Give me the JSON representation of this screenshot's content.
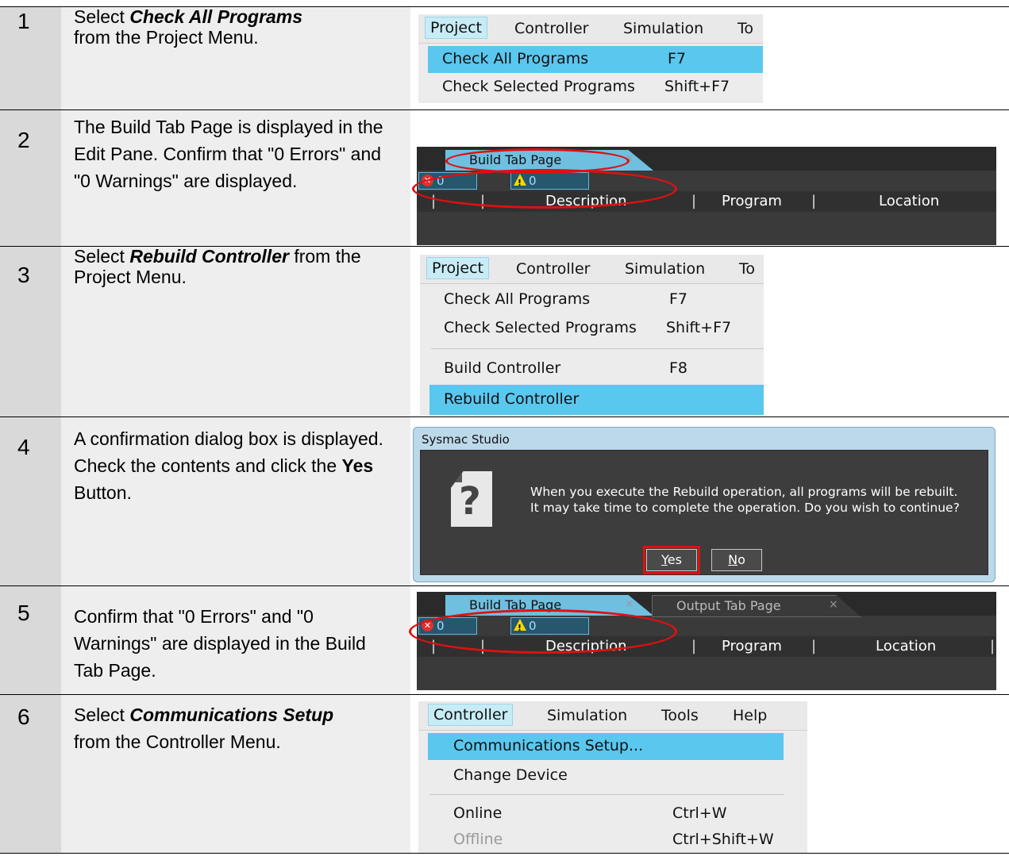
{
  "steps": [
    {
      "num": "1",
      "pre": "Select ",
      "bold": "Check All Programs",
      "post": " from the Project Menu."
    },
    {
      "num": "2",
      "text": "The Build Tab Page is displayed in the Edit Pane. Confirm that \"0 Errors\" and \"0 Warnings\" are displayed."
    },
    {
      "num": "3",
      "pre": "Select ",
      "bold": "Rebuild Controller",
      "post": " from the Project Menu."
    },
    {
      "num": "4",
      "pre": "A confirmation dialog box is displayed. Check the contents and click the ",
      "bold": "Yes",
      "post": " Button."
    },
    {
      "num": "5",
      "text": "Confirm that \"0 Errors\" and \"0 Warnings\" are displayed in the Build Tab Page."
    },
    {
      "num": "6",
      "pre": "Select ",
      "bold": "Communications Setup",
      "post": " from the Controller Menu."
    }
  ],
  "menu1": {
    "bar": [
      "Project",
      "Controller",
      "Simulation",
      "To"
    ],
    "items": [
      {
        "label": "Check All Programs",
        "shortcut": "F7"
      },
      {
        "label": "Check Selected Programs",
        "shortcut": "Shift+F7"
      }
    ]
  },
  "menu3": {
    "bar": [
      "Project",
      "Controller",
      "Simulation",
      "To"
    ],
    "items": [
      {
        "label": "Check All Programs",
        "shortcut": "F7"
      },
      {
        "label": "Check Selected Programs",
        "shortcut": "Shift+F7"
      },
      {
        "label": "Build Controller",
        "shortcut": "F8"
      },
      {
        "label": "Rebuild Controller",
        "shortcut": ""
      }
    ]
  },
  "menu6": {
    "bar": [
      "Controller",
      "Simulation",
      "Tools",
      "Help"
    ],
    "items": [
      {
        "label": "Communications Setup...",
        "shortcut": ""
      },
      {
        "label": "Change Device",
        "shortcut": ""
      },
      {
        "label": "Online",
        "shortcut": "Ctrl+W"
      },
      {
        "label": "Offline",
        "shortcut": "Ctrl+Shift+W"
      }
    ]
  },
  "build": {
    "tab_label": "Build Tab Page",
    "tab2_label": "Output Tab Page",
    "tab_close": "×",
    "errors": "0  Errors",
    "warnings": "0  Warnings",
    "cols": [
      "Description",
      "Program",
      "Location"
    ],
    "colsep": "|"
  },
  "dialog": {
    "title": "Sysmac Studio",
    "line1": "When you execute the Rebuild operation, all programs will be rebuilt.",
    "line2": "It may take time to complete the operation. Do you wish to continue?",
    "yes": "Yes",
    "no": "No"
  },
  "colors": {
    "menu_highlight": "#5ac7ee",
    "marker": "#e01010",
    "pane_bg": "#3a3a3a"
  }
}
